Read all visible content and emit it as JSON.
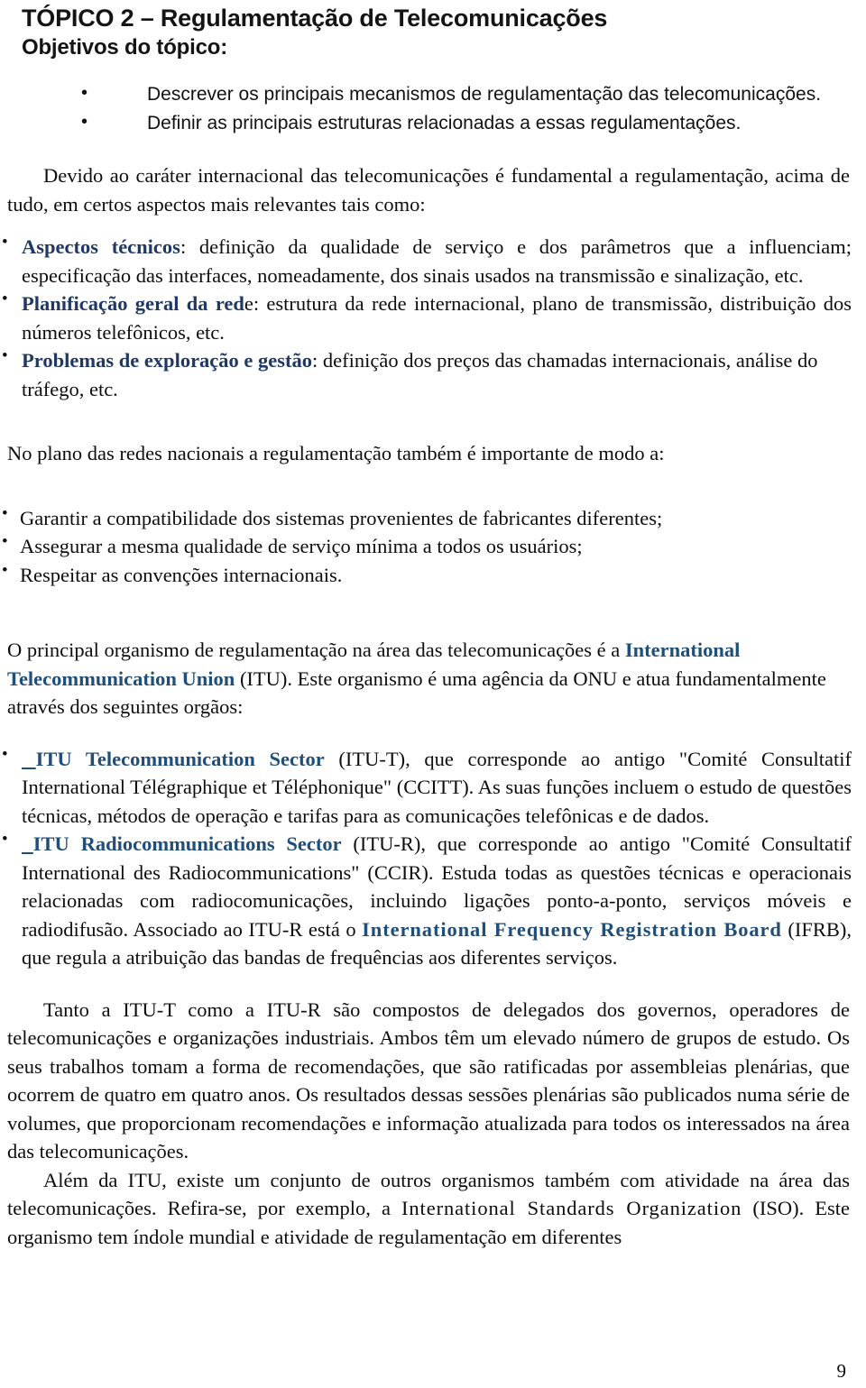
{
  "document": {
    "title": "TÓPICO 2 – Regulamentação de Telecomunicações",
    "subtitle": "Objetivos do tópico:",
    "page_number": "9"
  },
  "colors": {
    "heading_blue_dark": "#1f3864",
    "heading_blue": "#1f4e79",
    "body_text": "#0d0d0d",
    "title_text": "#141414",
    "page_background": "#ffffff"
  },
  "objectives": {
    "items": [
      "Descrever os principais mecanismos de regulamentação das telecomunicações.",
      "Definir as principais estruturas relacionadas a essas regulamentações."
    ]
  },
  "intro_paragraph": "Devido ao caráter internacional das telecomunicações é fundamental a regulamentação, acima de tudo, em certos aspectos mais relevantes tais como:",
  "aspects_list": [
    {
      "label": "Aspectos técnicos",
      "body": ": definição da qualidade de serviço e dos parâmetros que a influenciam; especificação das interfaces, nomeadamente, dos sinais usados na transmissão e sinalização, etc."
    },
    {
      "label": "Planificação geral da red",
      "body": "e: estrutura da rede internacional, plano de transmissão, distribuição dos números telefônicos, etc."
    },
    {
      "label": "Problemas de exploração e gestão",
      "body": ": definição dos preços das chamadas internacionais, análise do tráfego, etc."
    }
  ],
  "national_intro": "No plano das redes nacionais a regulamentação também é importante de modo a:",
  "national_list": [
    "Garantir a compatibilidade dos sistemas provenientes de fabricantes diferentes;",
    "Assegurar a mesma qualidade de serviço mínima a todos os usuários;",
    "Respeitar as convenções internacionais."
  ],
  "itu_paragraph": {
    "before": "O principal organismo de regulamentação na área das telecomunicações é a ",
    "highlight": "International Telecommunication Union",
    "after": " (ITU). Este organismo é uma agência da ONU e atua fundamentalmente através dos seguintes orgãos:"
  },
  "itu_sectors": [
    {
      "label": "ITU Telecommunication Sector",
      "body": " (ITU-T), que corresponde ao antigo \"Comité Consultatif International Télégraphique et Téléphonique\" (CCITT). As suas funções incluem o estudo de questões técnicas, métodos de operação e tarifas para as comunicações telefônicas e de dados."
    },
    {
      "label": "ITU Radiocommunications Sector",
      "body_before": " (ITU-R), que corresponde ao antigo \"Comité Consultatif International des Radiocommunications\" (CCIR). Estuda todas as questões técnicas e operacionais relacionadas com radiocomunicações, incluindo ligações ponto-a-ponto, serviços móveis e radiodifusão. Associado ao ITU-R está o ",
      "inner_highlight": "International Frequency Registration Board",
      "body_after": " (IFRB), que regula a atribuição das bandas de frequências aos diferentes serviços."
    }
  ],
  "closing_paragraphs": {
    "first": "Tanto a ITU-T como a ITU-R são compostos de delegados dos governos, operadores de telecomunicações e organizações industriais. Ambos têm um elevado número de grupos de estudo. Os seus trabalhos tomam a forma de recomendações, que são ratificadas por assembleias plenárias, que ocorrem de quatro em quatro anos. Os resultados dessas sessões plenárias são publicados numa série de volumes, que proporcionam recomendações e informação atualizada para todos os interessados na área das telecomunicações.",
    "second_before": "Além da ITU, existe um conjunto de outros organismos também com atividade na área das telecomunicações. Refira-se, por exemplo, a ",
    "second_spaced": "International Standards Organization",
    "second_after": " (ISO). Este organismo tem índole mundial e atividade de regulamentação em diferentes"
  }
}
